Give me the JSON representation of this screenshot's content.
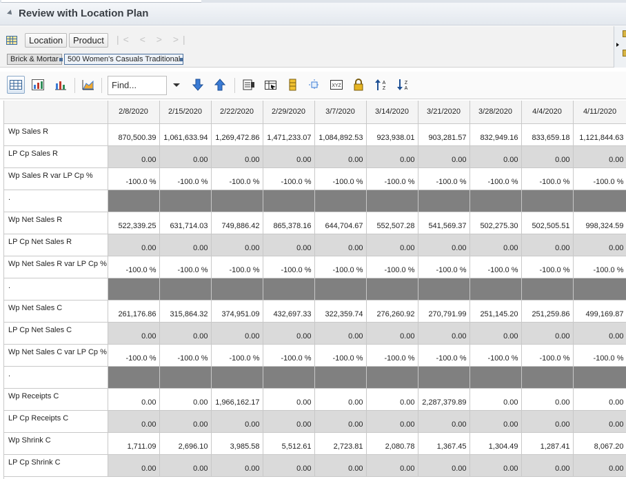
{
  "title": "Review with Location Plan",
  "dimensions": {
    "location_label": "Location",
    "product_label": "Product"
  },
  "filters": {
    "chip1": "Brick & Mortar",
    "chip2": "500 Women's Casuals Traditional"
  },
  "nav_arrows": "|< < > >|",
  "toolbar": {
    "find_placeholder": "Find..."
  },
  "colors": {
    "title_bg": "#e3e8ee",
    "gray_row": "#dadada",
    "separator_row": "#808080",
    "accent_blue": "#3a7bd5"
  },
  "grid": {
    "columns": [
      "2/8/2020",
      "2/15/2020",
      "2/22/2020",
      "2/29/2020",
      "3/7/2020",
      "3/14/2020",
      "3/21/2020",
      "3/28/2020",
      "4/4/2020",
      "4/11/2020"
    ],
    "rows": [
      {
        "label": "Wp Sales R",
        "style": "white",
        "values": [
          "870,500.39",
          "1,061,633.94",
          "1,269,472.86",
          "1,471,233.07",
          "1,084,892.53",
          "923,938.01",
          "903,281.57",
          "832,949.16",
          "833,659.18",
          "1,121,844.63"
        ]
      },
      {
        "label": "LP Cp Sales R",
        "style": "gray",
        "values": [
          "0.00",
          "0.00",
          "0.00",
          "0.00",
          "0.00",
          "0.00",
          "0.00",
          "0.00",
          "0.00",
          "0.00"
        ]
      },
      {
        "label": "Wp Sales R var LP Cp %",
        "style": "white",
        "values": [
          "-100.0 %",
          "-100.0 %",
          "-100.0 %",
          "-100.0 %",
          "-100.0 %",
          "-100.0 %",
          "-100.0 %",
          "-100.0 %",
          "-100.0 %",
          "-100.0 %"
        ]
      },
      {
        "label": ".",
        "style": "dark",
        "values": [
          "",
          "",
          "",
          "",
          "",
          "",
          "",
          "",
          "",
          ""
        ]
      },
      {
        "label": "Wp Net Sales R",
        "style": "white",
        "values": [
          "522,339.25",
          "631,714.03",
          "749,886.42",
          "865,378.16",
          "644,704.67",
          "552,507.28",
          "541,569.37",
          "502,275.30",
          "502,505.51",
          "998,324.59"
        ]
      },
      {
        "label": "LP Cp Net Sales R",
        "style": "gray",
        "values": [
          "0.00",
          "0.00",
          "0.00",
          "0.00",
          "0.00",
          "0.00",
          "0.00",
          "0.00",
          "0.00",
          "0.00"
        ]
      },
      {
        "label": "Wp Net Sales R var LP Cp %",
        "style": "white",
        "values": [
          "-100.0 %",
          "-100.0 %",
          "-100.0 %",
          "-100.0 %",
          "-100.0 %",
          "-100.0 %",
          "-100.0 %",
          "-100.0 %",
          "-100.0 %",
          "-100.0 %"
        ]
      },
      {
        "label": ".",
        "style": "dark",
        "values": [
          "",
          "",
          "",
          "",
          "",
          "",
          "",
          "",
          "",
          ""
        ]
      },
      {
        "label": "Wp Net Sales C",
        "style": "white",
        "values": [
          "261,176.86",
          "315,864.32",
          "374,951.09",
          "432,697.33",
          "322,359.74",
          "276,260.92",
          "270,791.99",
          "251,145.20",
          "251,259.86",
          "499,169.87"
        ]
      },
      {
        "label": "LP Cp Net Sales C",
        "style": "gray",
        "values": [
          "0.00",
          "0.00",
          "0.00",
          "0.00",
          "0.00",
          "0.00",
          "0.00",
          "0.00",
          "0.00",
          "0.00"
        ]
      },
      {
        "label": "Wp Net Sales C var LP Cp %",
        "style": "white",
        "values": [
          "-100.0 %",
          "-100.0 %",
          "-100.0 %",
          "-100.0 %",
          "-100.0 %",
          "-100.0 %",
          "-100.0 %",
          "-100.0 %",
          "-100.0 %",
          "-100.0 %"
        ]
      },
      {
        "label": ".",
        "style": "dark",
        "values": [
          "",
          "",
          "",
          "",
          "",
          "",
          "",
          "",
          "",
          ""
        ]
      },
      {
        "label": "Wp Receipts C",
        "style": "white",
        "values": [
          "0.00",
          "0.00",
          "1,966,162.17",
          "0.00",
          "0.00",
          "0.00",
          "2,287,379.89",
          "0.00",
          "0.00",
          "0.00"
        ]
      },
      {
        "label": "LP Cp Receipts C",
        "style": "gray",
        "values": [
          "0.00",
          "0.00",
          "0.00",
          "0.00",
          "0.00",
          "0.00",
          "0.00",
          "0.00",
          "0.00",
          "0.00"
        ]
      },
      {
        "label": "Wp Shrink C",
        "style": "white",
        "values": [
          "1,711.09",
          "2,696.10",
          "3,985.58",
          "5,512.61",
          "2,723.81",
          "2,080.78",
          "1,367.45",
          "1,304.49",
          "1,287.41",
          "8,067.20"
        ]
      },
      {
        "label": "LP Cp Shrink C",
        "style": "gray",
        "values": [
          "0.00",
          "0.00",
          "0.00",
          "0.00",
          "0.00",
          "0.00",
          "0.00",
          "0.00",
          "0.00",
          "0.00"
        ]
      }
    ]
  }
}
